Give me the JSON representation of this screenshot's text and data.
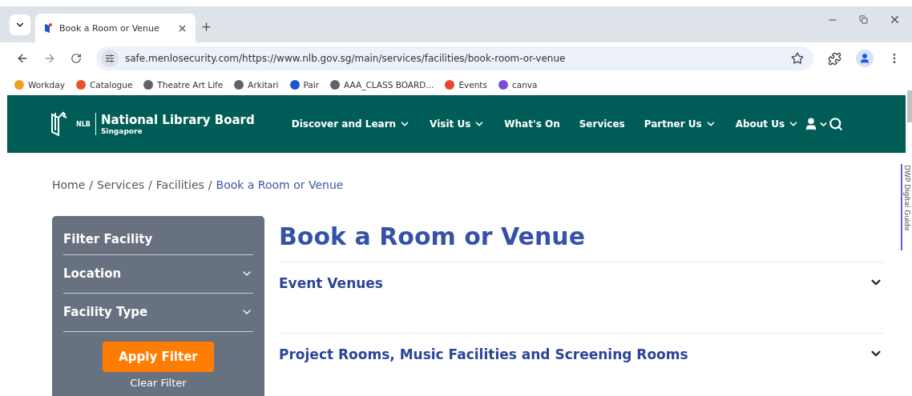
{
  "browser": {
    "tab": {
      "title": "Book a Room or Venue",
      "selected": true
    },
    "url": "safe.menlosecurity.com/https://www.nlb.gov.sg/main/services/facilities/book-room-or-venue",
    "bookmarks": [
      {
        "label": "Workday",
        "color": "#f0a020"
      },
      {
        "label": "Catalogue",
        "color": "#e8542a"
      },
      {
        "label": "Theatre Art Life",
        "color": "#5f6368"
      },
      {
        "label": "Arkitari",
        "color": "#5f6368"
      },
      {
        "label": "Pair",
        "color": "#1a56d6"
      },
      {
        "label": "AAA_CLASS BOARD...",
        "color": "#5f6368"
      },
      {
        "label": "Events",
        "color": "#e8452a"
      },
      {
        "label": "canva",
        "color": "#7b4ce0"
      }
    ]
  },
  "header": {
    "logo_mark": "NLB",
    "logo_title": "National Library Board",
    "logo_subtitle": "Singapore",
    "nav": [
      {
        "label": "Discover and Learn",
        "dropdown": true
      },
      {
        "label": "Visit Us",
        "dropdown": true
      },
      {
        "label": "What's On",
        "dropdown": false
      },
      {
        "label": "Services",
        "dropdown": false
      },
      {
        "label": "Partner Us",
        "dropdown": true
      },
      {
        "label": "About Us",
        "dropdown": true
      }
    ]
  },
  "breadcrumb_separator": "/",
  "breadcrumb": [
    {
      "label": "Home",
      "current": false
    },
    {
      "label": "Services",
      "current": false
    },
    {
      "label": "Facilities",
      "current": false
    },
    {
      "label": "Book a Room or Venue",
      "current": true
    }
  ],
  "filter": {
    "title": "Filter Facility",
    "fields": [
      {
        "label": "Location",
        "expanded": false
      },
      {
        "label": "Facility Type",
        "expanded": false
      }
    ],
    "apply": "Apply Filter",
    "clear": "Clear Filter"
  },
  "page_title": "Book a Room or Venue",
  "sections": [
    {
      "title": "Event Venues",
      "expanded": false
    },
    {
      "title": "Project Rooms, Music Facilities and Screening Rooms",
      "expanded": false
    }
  ],
  "side_tab": "DWP Digital Guide"
}
